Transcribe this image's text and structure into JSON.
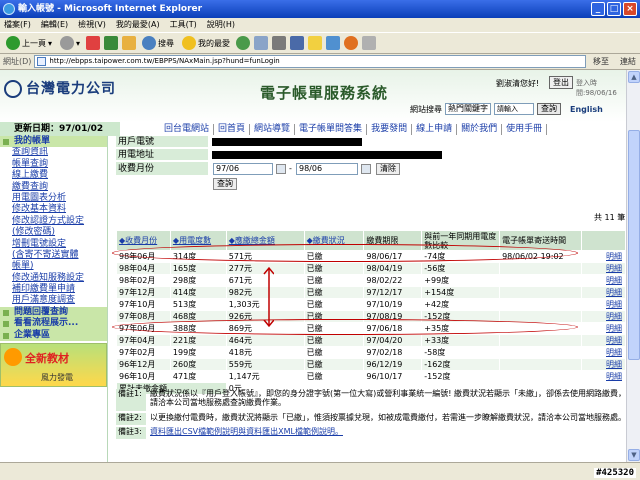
{
  "window": {
    "title": "輸入帳號 - Microsoft Internet Explorer"
  },
  "menu": [
    "檔案(F)",
    "編輯(E)",
    "檢視(V)",
    "我的最愛(A)",
    "工具(T)",
    "說明(H)"
  ],
  "toolbar": {
    "back": "上一頁",
    "search": "搜尋",
    "favorites": "我的最愛"
  },
  "address": {
    "label": "網址(D)",
    "url": "http://ebpps.taipower.com.tw/EBPPS/NAxMain.jsp?hund=funLogin",
    "go": "移至",
    "links": "連結"
  },
  "header": {
    "logo": "台灣電力公司",
    "title": "電子帳單服務系統",
    "welcome": "劉淑清您好!",
    "logout": "登出",
    "login_time": "登入時間:98/06/16",
    "site_search_label": "網站搜尋",
    "keyword_select": "熱門關鍵字",
    "keyword_placeholder": "請輸入",
    "query": "查詢",
    "english": "English"
  },
  "nav": {
    "updated": "更新日期：97/01/02",
    "links": [
      "回台電網站",
      "回首頁",
      "網站導覽",
      "電子帳單問答集",
      "我要發問",
      "線上申請",
      "關於我們",
      "使用手冊"
    ]
  },
  "sidebar": {
    "items": [
      {
        "label": "我的帳單",
        "type": "sec"
      },
      {
        "label": "查詢資訊",
        "type": "link"
      },
      {
        "label": "帳單查詢",
        "type": "link"
      },
      {
        "label": "線上繳費",
        "type": "link"
      },
      {
        "label": "繳費查詢",
        "type": "link"
      },
      {
        "label": "用電圖表分析",
        "type": "link"
      },
      {
        "label": "修改基本資料",
        "type": "link"
      },
      {
        "label": "修改認證方式設定",
        "type": "link"
      },
      {
        "label": "(修改密碼)",
        "type": "link"
      },
      {
        "label": "增刪電號設定",
        "type": "link"
      },
      {
        "label": "(含寄不寄送實體",
        "type": "link"
      },
      {
        "label": "帳單)",
        "type": "link"
      },
      {
        "label": "修改通知服務設定",
        "type": "link"
      },
      {
        "label": "補印繳費單申請",
        "type": "link"
      },
      {
        "label": "用戶滿意度調查",
        "type": "link"
      },
      {
        "label": "問題回覆查詢",
        "type": "sec"
      },
      {
        "label": "看看流程展示...",
        "type": "sec"
      },
      {
        "label": "企業專區",
        "type": "sec"
      }
    ],
    "promo_title": "全新教材",
    "promo_sub": "風力發電"
  },
  "form": {
    "customer_no_label": "用戶電號",
    "address_label": "用電地址",
    "month_label": "收費月份",
    "from": "97/06",
    "to": "98/06",
    "clear": "清除",
    "query": "查詢"
  },
  "table": {
    "total": "共 11 筆",
    "headers": [
      "◆收費月份",
      "◆用電度數",
      "◆應繳總金額",
      "◆繳費狀況",
      "繳費期限",
      "與前一年同期用電度數比較",
      "電子帳單寄送時間",
      ""
    ],
    "rows": [
      [
        "98年06月",
        "314度",
        "571元",
        "已繳",
        "98/06/17",
        "-74度",
        "98/06/02 19:02",
        "明細"
      ],
      [
        "98年04月",
        "165度",
        "277元",
        "已繳",
        "98/04/19",
        "-56度",
        "",
        "明細"
      ],
      [
        "98年02月",
        "298度",
        "671元",
        "已繳",
        "98/02/22",
        "+99度",
        "",
        "明細"
      ],
      [
        "97年12月",
        "414度",
        "982元",
        "已繳",
        "97/12/17",
        "+154度",
        "",
        "明細"
      ],
      [
        "97年10月",
        "513度",
        "1,303元",
        "已繳",
        "97/10/19",
        "+42度",
        "",
        "明細"
      ],
      [
        "97年08月",
        "468度",
        "926元",
        "已繳",
        "97/08/19",
        "-152度",
        "",
        "明細"
      ],
      [
        "97年06月",
        "388度",
        "869元",
        "已繳",
        "97/06/18",
        "+35度",
        "",
        "明細"
      ],
      [
        "97年04月",
        "221度",
        "464元",
        "已繳",
        "97/04/20",
        "+33度",
        "",
        "明細"
      ],
      [
        "97年02月",
        "199度",
        "418元",
        "已繳",
        "97/02/18",
        "-58度",
        "",
        "明細"
      ],
      [
        "96年12月",
        "260度",
        "559元",
        "已繳",
        "96/12/19",
        "-162度",
        "",
        "明細"
      ],
      [
        "96年10月",
        "471度",
        "1,147元",
        "已繳",
        "96/10/17",
        "-152度",
        "",
        "明細"
      ]
    ],
    "unpaid_label": "累計未繳金額",
    "unpaid_value": "0元"
  },
  "notes": [
    {
      "label": "備註1:",
      "text": "繳費狀況係以『用戶登入帳號』，即您的身分證字號(第一位大寫)或營利事業統一編號! 繳費狀況若顯示「未繳」，卻係去使用網路繳費，請洽本公司當地服務處查詢繳費作業。"
    },
    {
      "label": "備註2:",
      "text": "以更換繳付電費時，繳費狀況將顯示「已繳」，惟須按票據兌現，如被成電費繳付，若需進一步瞭解繳費狀況，請洽本公司當地服務處。"
    },
    {
      "label": "備註3:",
      "text": "資料匯出CSV檔範例說明與資料匯出XML檔範例說明。"
    }
  ],
  "watermark": "#425320"
}
